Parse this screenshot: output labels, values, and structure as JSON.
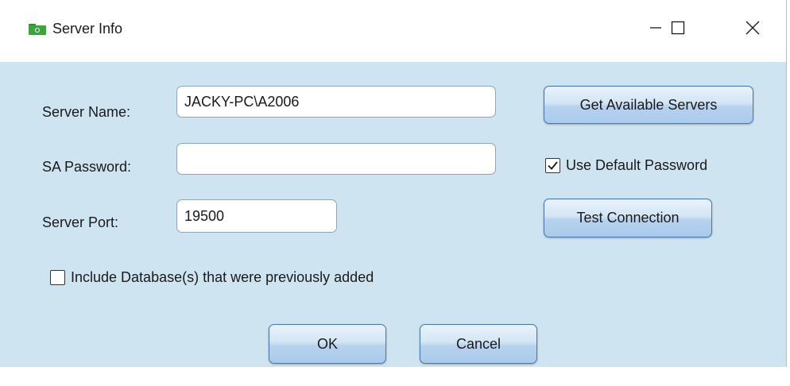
{
  "window": {
    "title": "Server Info"
  },
  "form": {
    "server_name_label": "Server Name:",
    "server_name_value": "JACKY-PC\\A2006",
    "sa_password_label": "SA Password:",
    "sa_password_value": "",
    "server_port_label": "Server Port:",
    "server_port_value": "19500"
  },
  "actions": {
    "get_servers_label": "Get Available Servers",
    "test_connection_label": "Test Connection",
    "ok_label": "OK",
    "cancel_label": "Cancel"
  },
  "options": {
    "use_default_password_label": "Use Default Password",
    "use_default_password_checked": true,
    "include_databases_label": "Include Database(s) that were previously added",
    "include_databases_checked": false
  },
  "colors": {
    "client_background": "#cfe4f1",
    "button_border": "#4a76a8",
    "app_icon": "#3aa53a"
  },
  "icons": {
    "app": "folder-icon",
    "minimize": "minimize-icon",
    "maximize": "maximize-icon",
    "close": "close-icon",
    "check": "checkmark-icon"
  }
}
